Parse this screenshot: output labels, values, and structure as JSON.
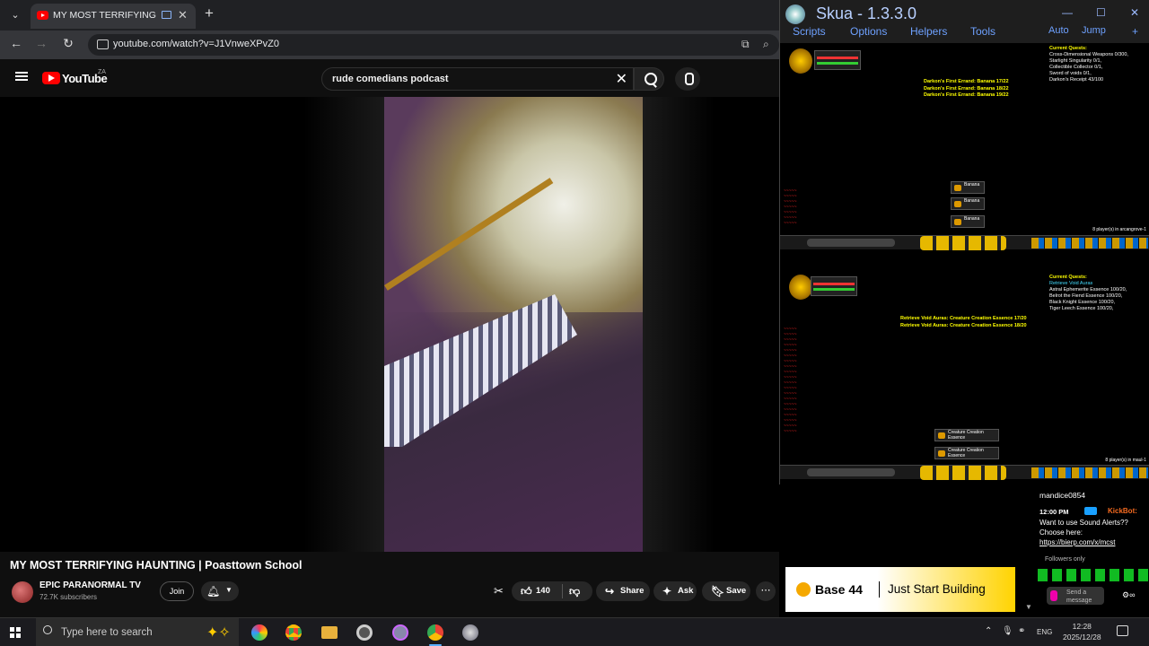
{
  "browser": {
    "tab_title": "MY MOST TERRIFYING HAU",
    "url": "youtube.com/watch?v=J1VnweXPvZ0"
  },
  "youtube": {
    "logo_text": "YouTube",
    "country_code": "ZA",
    "search_query": "rude comedians podcast",
    "video_title": "MY MOST TERRIFYING HAUNTING | Poasttown School",
    "channel_name": "EPIC PARANORMAL TV",
    "subscribers": "72.7K subscribers",
    "join_label": "Join",
    "like_count": "140",
    "share_label": "Share",
    "ask_label": "Ask",
    "save_label": "Save"
  },
  "skua": {
    "title": "Skua - 1.3.3.0",
    "menu": [
      "Scripts",
      "Options",
      "Helpers",
      "Tools"
    ],
    "menu_right": [
      "Auto",
      "Jump"
    ],
    "client1": {
      "quest_header": "Current Quests:",
      "quests": [
        "Cross-Dimensional Weapons 0/300,",
        "Starlight Singularity 0/1,",
        "Collectible Collector 0/1,",
        "Sword of voids 0/1,",
        "Darkon's Receipt 43/100"
      ],
      "yellow": [
        "Darkon's First Errand: Banana 17/22",
        "Darkon's First Errand: Banana 18/22",
        "Darkon's First Errand: Banana 19/22"
      ],
      "drop_item": "Banana",
      "players": "8 player(s) in arcangrove-1"
    },
    "client2": {
      "quest_header": "Current Quests:",
      "quests": [
        "Retrieve Void Auras",
        "Astral Ephemerite Essence 100/20,",
        "Belrot the Fiend Essence 100/20,",
        "Black Knight Essence 100/20,",
        "Tiger Leech Essence 100/20,"
      ],
      "yellow": [
        "Retrieve Void Auras: Creature Creation Essence 17/20",
        "Retrieve Void Auras: Creature Creation Essence 18/20"
      ],
      "drop_item": "Creature Creation Essence",
      "players": "8 player(s) in maul-1"
    }
  },
  "chat": {
    "username": "mandice0854",
    "time": "12:00 PM",
    "bot_name": "KickBot:",
    "message": "Want to use Sound Alerts?? Choose here:",
    "link": "https://bierp.com/x/mcst",
    "followers_only": "Followers only",
    "send_placeholder": "Send a message"
  },
  "ad": {
    "brand": "Base 44",
    "tagline": "Just Start Building"
  },
  "taskbar": {
    "search_placeholder": "Type here to search",
    "language": "ENG",
    "time": "12:28",
    "date": "2025/12/28"
  }
}
